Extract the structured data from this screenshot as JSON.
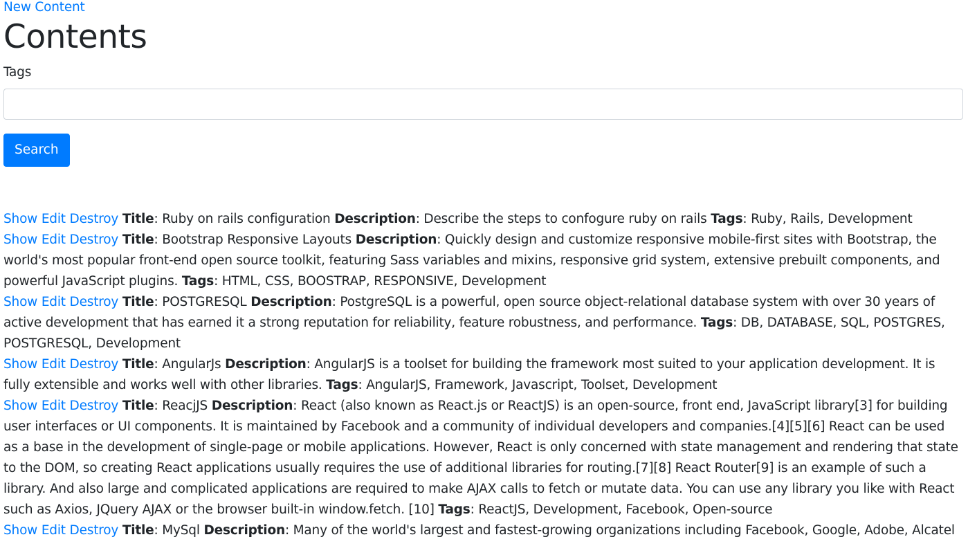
{
  "header": {
    "new_link": "New Content",
    "title": "Contents"
  },
  "search": {
    "label": "Tags",
    "value": "",
    "placeholder": "",
    "button": "Search"
  },
  "labels": {
    "show": "Show",
    "edit": "Edit",
    "destroy": "Destroy",
    "title": "Title",
    "description": "Description",
    "tags": "Tags"
  },
  "items": [
    {
      "title": "Ruby on rails configuration",
      "description": "Describe the steps to confogure ruby on rails",
      "tags": "Ruby, Rails, Development"
    },
    {
      "title": "Bootstrap Responsive Layouts",
      "description": "Quickly design and customize responsive mobile-first sites with Bootstrap, the world's most popular front-end open source toolkit, featuring Sass variables and mixins, responsive grid system, extensive prebuilt components, and powerful JavaScript plugins.",
      "tags": "HTML, CSS, BOOSTRAP, RESPONSIVE, Development"
    },
    {
      "title": "POSTGRESQL",
      "description": "PostgreSQL is a powerful, open source object-relational database system with over 30 years of active development that has earned it a strong reputation for reliability, feature robustness, and performance.",
      "tags": "DB, DATABASE, SQL, POSTGRES, POSTGRESQL, Development"
    },
    {
      "title": "AngularJs",
      "description": "AngularJS is a toolset for building the framework most suited to your application development. It is fully extensible and works well with other libraries.",
      "tags": "AngularJS, Framework, Javascript, Toolset, Development"
    },
    {
      "title": "ReacjJS",
      "description": "React (also known as React.js or ReactJS) is an open-source, front end, JavaScript library[3] for building user interfaces or UI components. It is maintained by Facebook and a community of individual developers and companies.[4][5][6] React can be used as a base in the development of single-page or mobile applications. However, React is only concerned with state management and rendering that state to the DOM, so creating React applications usually requires the use of additional libraries for routing.[7][8] React Router[9] is an example of such a library. And also large and complicated applications are required to make AJAX calls to fetch or mutate data. You can use any library you like with React such as Axios, JQuery AJAX or the browser built-in window.fetch. [10]",
      "tags": "ReactJS, Development, Facebook, Open-source"
    },
    {
      "title": "MySql",
      "description": "Many of the world's largest and fastest-growing organizations including Facebook, Google, Adobe, Alcatel",
      "tags": ""
    }
  ],
  "colors": {
    "link": "#007bff",
    "button_bg": "#007bff",
    "text": "#212529",
    "input_border": "#ced4da"
  }
}
